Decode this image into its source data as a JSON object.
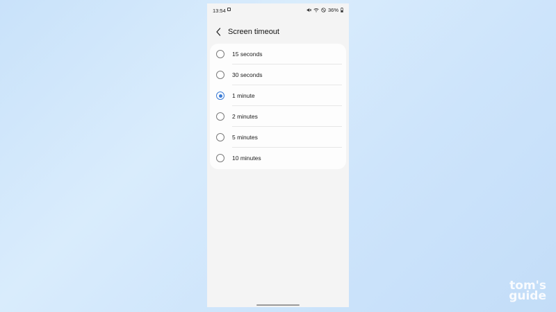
{
  "status_bar": {
    "time": "13:54",
    "battery": "36%",
    "icons": [
      "gallery-icon",
      "mute-icon",
      "wifi-icon",
      "do-not-disturb-icon",
      "battery-icon"
    ]
  },
  "header": {
    "back_icon": "back-arrow-icon",
    "title": "Screen timeout"
  },
  "options": [
    {
      "label": "15 seconds",
      "selected": false
    },
    {
      "label": "30 seconds",
      "selected": false
    },
    {
      "label": "1 minute",
      "selected": true
    },
    {
      "label": "2 minutes",
      "selected": false
    },
    {
      "label": "5 minutes",
      "selected": false
    },
    {
      "label": "10 minutes",
      "selected": false
    }
  ],
  "watermark": {
    "line1": "tom's",
    "line2": "guide"
  },
  "colors": {
    "accent": "#3a7bd5",
    "background": "#f4f4f4",
    "card": "#fdfdfd"
  }
}
